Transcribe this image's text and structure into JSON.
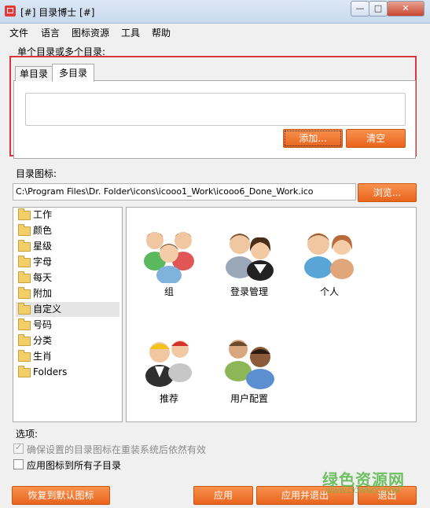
{
  "window": {
    "title": "[#] 目录博士 [#]",
    "controls": {
      "minimize": "—",
      "maximize": "□",
      "close": "✕"
    }
  },
  "menu": [
    "文件",
    "语言",
    "图标资源",
    "工具",
    "帮助"
  ],
  "section_dirs": {
    "label": "单个目录或多个目录:",
    "tabs": [
      "单目录",
      "多目录"
    ],
    "active_tab": "多目录",
    "add_button": "添加...",
    "clear_button": "清空"
  },
  "section_icon": {
    "label": "目录图标:",
    "path": "C:\\Program Files\\Dr. Folder\\icons\\icooo1_Work\\icooo6_Done_Work.ico",
    "browse_button": "浏览..."
  },
  "tree": [
    "工作",
    "颜色",
    "星级",
    "字母",
    "每天",
    "附加",
    "自定义",
    "号码",
    "分类",
    "生肖",
    "Folders"
  ],
  "tree_selected": "自定义",
  "icons": [
    "组",
    "登录管理",
    "个人",
    "推荐",
    "用户配置"
  ],
  "options": {
    "label": "选项:",
    "keep_after_reinstall": "确保设置的目录图标在重装系统后依然有效",
    "apply_subfolders": "应用图标到所有子目录"
  },
  "footer": {
    "restore_button": "恢复到默认图标",
    "apply_button": "应用",
    "apply_exit_button": "应用并退出",
    "exit_button": "退出"
  },
  "watermark": {
    "text": "绿色资源网",
    "sub": "WWW.DOWNCC.COM"
  },
  "colors": {
    "accent": "#ed6d25",
    "highlight_border": "#d9373f"
  }
}
